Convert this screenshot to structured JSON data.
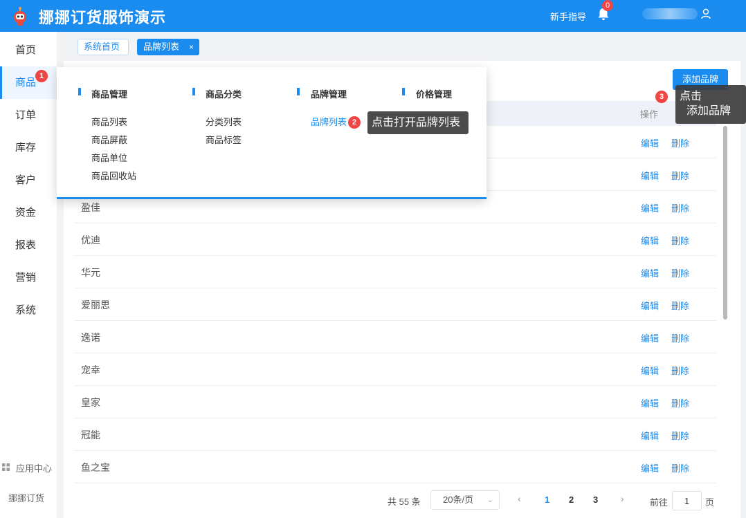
{
  "header": {
    "title": "挪挪订货服饰演示",
    "guide": "新手指导",
    "notification_count": "0"
  },
  "sidebar": {
    "items": [
      {
        "label": "首页"
      },
      {
        "label": "商品"
      },
      {
        "label": "订单"
      },
      {
        "label": "库存"
      },
      {
        "label": "客户"
      },
      {
        "label": "资金"
      },
      {
        "label": "报表"
      },
      {
        "label": "营销"
      },
      {
        "label": "系统"
      }
    ],
    "app_center": "应用中心",
    "brand": "挪挪订货"
  },
  "tabs": {
    "home": "系统首页",
    "current": "品牌列表",
    "close": "×"
  },
  "menu": {
    "columns": [
      {
        "title": "商品管理",
        "links": [
          "商品列表",
          "商品屏蔽",
          "商品单位",
          "商品回收站"
        ]
      },
      {
        "title": "商品分类",
        "links": [
          "分类列表",
          "商品标签"
        ]
      },
      {
        "title": "品牌管理",
        "links": [
          "品牌列表"
        ]
      },
      {
        "title": "价格管理",
        "links": []
      }
    ]
  },
  "toolbar": {
    "add_label": "添加品牌"
  },
  "table": {
    "op_header": "操作",
    "edit_label": "编辑",
    "delete_label": "删除",
    "rows": [
      "",
      "",
      "盈佳",
      "优迪",
      "华元",
      "爱丽思",
      "逸诺",
      "宠幸",
      "皇家",
      "冠能",
      "鱼之宝"
    ]
  },
  "pagination": {
    "total": "共 55 条",
    "page_size": "20条/页",
    "prev": "‹",
    "next": "›",
    "pages": [
      "1",
      "2",
      "3"
    ],
    "goto_label": "前往",
    "goto_value": "1",
    "goto_unit": "页"
  },
  "guides": {
    "step1": "1",
    "step2": "2",
    "step3": "3",
    "tip1": "点击打开品牌列表",
    "tip2_line1": "点击",
    "tip2_line2": "添加品牌"
  },
  "colors": {
    "primary": "#1a8cf0",
    "badge": "#f04545"
  }
}
